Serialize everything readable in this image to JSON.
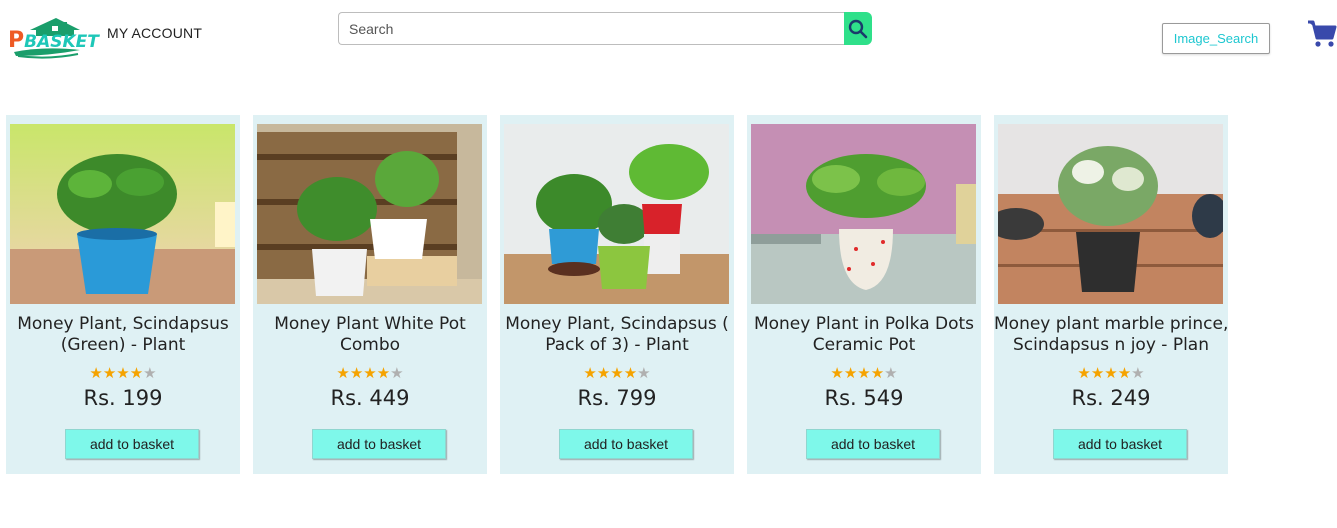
{
  "brand": {
    "logo_text_p": "P",
    "logo_text_rest": "BASKET"
  },
  "header": {
    "my_account_label": "MY ACCOUNT",
    "search_placeholder": "Search",
    "image_search_label": "Image_Search"
  },
  "colors": {
    "accent": "#1ec7d0",
    "search_button": "#2fe08a",
    "card_bg": "#dff1f4",
    "add_button": "#7ef8ea",
    "cart": "#3949ab",
    "star": "#f5a300"
  },
  "products": [
    {
      "title_line1": "Money Plant, Scindapsus",
      "title_line2": "(Green) - Plant",
      "rating": 4,
      "rating_max": 5,
      "price": "Rs. 199",
      "button_label": "add to basket"
    },
    {
      "title_line1": "Money Plant White Pot",
      "title_line2": "Combo",
      "rating": 4,
      "rating_max": 5,
      "price": "Rs. 449",
      "button_label": "add to basket"
    },
    {
      "title_line1": "Money Plant, Scindapsus (",
      "title_line2": "Pack of 3) - Plant",
      "rating": 4,
      "rating_max": 5,
      "price": "Rs. 799",
      "button_label": "add to basket"
    },
    {
      "title_line1": "Money Plant in Polka Dots",
      "title_line2": "Ceramic Pot",
      "rating": 4,
      "rating_max": 5,
      "price": "Rs. 549",
      "button_label": "add to basket"
    },
    {
      "title_line1": "Money plant marble prince,",
      "title_line2": "Scindapsus n joy - Plan",
      "rating": 4,
      "rating_max": 5,
      "price": "Rs. 249",
      "button_label": "add to basket"
    }
  ]
}
